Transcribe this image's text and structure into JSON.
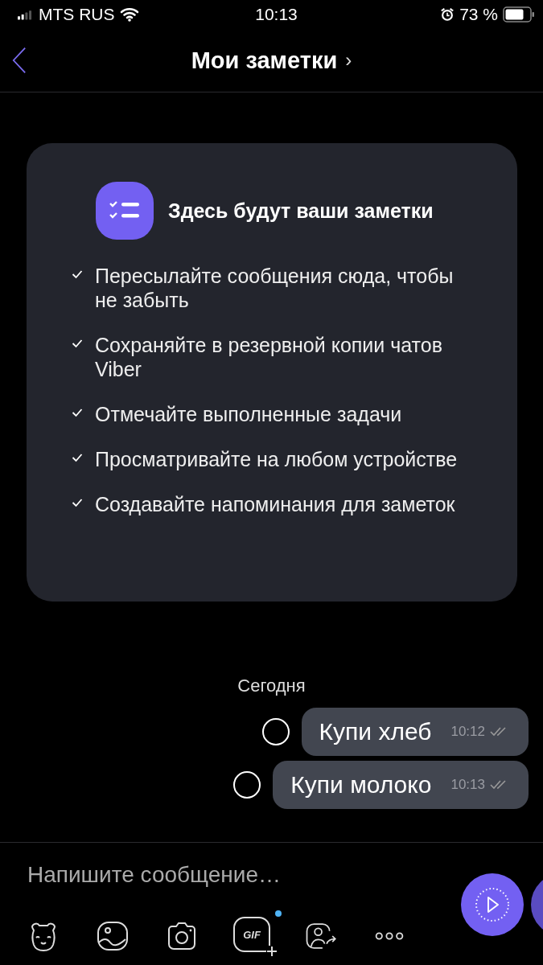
{
  "status_bar": {
    "carrier": "MTS RUS",
    "time": "10:13",
    "battery": "73 %"
  },
  "header": {
    "title": "Мои заметки",
    "chevron": "›"
  },
  "intro_card": {
    "title": "Здесь будут ваши заметки",
    "items": [
      {
        "text": "Пересылайте сообщения сюда, чтобы не забыть"
      },
      {
        "text": "Сохраняйте в резервной копии чатов Viber"
      },
      {
        "text": "Отмечайте выполненные задачи"
      },
      {
        "text": "Просматривайте на любом устройстве"
      },
      {
        "text": "Создавайте напоминания для заметок"
      }
    ]
  },
  "date_label": "Сегодня",
  "messages": [
    {
      "text": "Купи хлеб",
      "time": "10:12",
      "selected": false
    },
    {
      "text": "Купи молоко",
      "time": "10:13",
      "selected": false
    }
  ],
  "composer": {
    "placeholder": "Напишите сообщение…",
    "gif_label": "GIF",
    "gif_new": true
  }
}
